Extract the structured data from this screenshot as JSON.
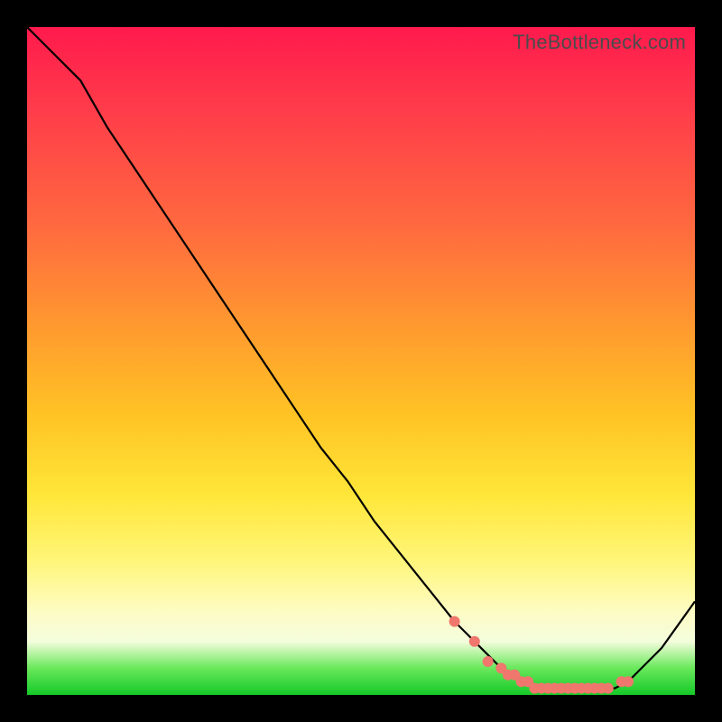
{
  "watermark": "TheBottleneck.com",
  "chart_data": {
    "type": "line",
    "title": "",
    "xlabel": "",
    "ylabel": "",
    "xlim": [
      0,
      100
    ],
    "ylim": [
      0,
      100
    ],
    "grid": false,
    "series": [
      {
        "name": "curve",
        "x": [
          0,
          4,
          8,
          12,
          16,
          20,
          24,
          28,
          32,
          36,
          40,
          44,
          48,
          52,
          56,
          60,
          64,
          68,
          71,
          73,
          75,
          77,
          79,
          81,
          83,
          85,
          88,
          90,
          92,
          95,
          100
        ],
        "values": [
          100,
          96,
          92,
          85,
          79,
          73,
          67,
          61,
          55,
          49,
          43,
          37,
          32,
          26,
          21,
          16,
          11,
          7,
          4,
          3,
          2,
          1,
          1,
          1,
          1,
          1,
          1,
          2,
          4,
          7,
          14
        ]
      }
    ],
    "markers": {
      "name": "highlight-dots",
      "x": [
        64,
        67,
        69,
        71,
        72,
        73,
        74,
        75,
        76,
        77,
        78,
        79,
        80,
        81,
        82,
        83,
        84,
        85,
        86,
        87,
        89,
        90
      ],
      "values": [
        11,
        8,
        5,
        4,
        3,
        3,
        2,
        2,
        1,
        1,
        1,
        1,
        1,
        1,
        1,
        1,
        1,
        1,
        1,
        1,
        2,
        2
      ]
    }
  },
  "colors": {
    "background": "#000000",
    "curve": "#000000",
    "dots": "#f0776d"
  }
}
